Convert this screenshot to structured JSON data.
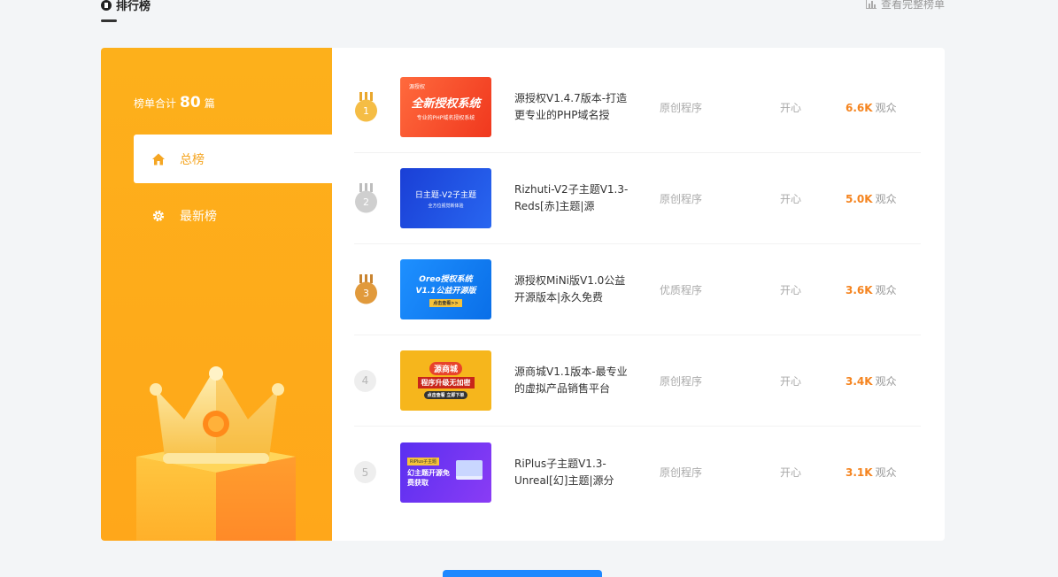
{
  "header": {
    "title": "排行榜",
    "link_label": "查看完整榜单"
  },
  "summary": {
    "prefix": "榜单合计",
    "count": "80",
    "suffix": "篇"
  },
  "nav": [
    {
      "label": "总榜",
      "icon": "home-icon",
      "active": true
    },
    {
      "label": "最新榜",
      "icon": "gear-icon",
      "active": false
    }
  ],
  "rows": [
    {
      "rank": "1",
      "thumb_text": "全新授权系统",
      "thumb_sub": "专业的PHP域名授权系统",
      "thumb_tag": "源授权",
      "title": "源授权V1.4.7版本-打造更专业的PHP域名授",
      "category": "原创程序",
      "author": "开心",
      "views": "6.6K",
      "views_unit": "观众"
    },
    {
      "rank": "2",
      "thumb_text": "日主题-V2子主题",
      "thumb_sub": "全方位视觉新体验",
      "thumb_tag": "",
      "title": "Rizhuti-V2子主题V1.3-Reds[赤]主题|源",
      "category": "原创程序",
      "author": "开心",
      "views": "5.0K",
      "views_unit": "观众"
    },
    {
      "rank": "3",
      "thumb_text": "Oreo授权系统",
      "thumb_sub": "V1.1公益开源版",
      "thumb_tag": "点击查看>>",
      "title": "源授权MiNi版V1.0公益开源版本|永久免费",
      "category": "优质程序",
      "author": "开心",
      "views": "3.6K",
      "views_unit": "观众"
    },
    {
      "rank": "4",
      "thumb_text": "源商城",
      "thumb_sub": "程序升级无加密",
      "thumb_tag": "点击查看 立即下单",
      "title": "源商城V1.1版本-最专业的虚拟产品销售平台",
      "category": "原创程序",
      "author": "开心",
      "views": "3.4K",
      "views_unit": "观众"
    },
    {
      "rank": "5",
      "thumb_text": "幻主题开源免费获取",
      "thumb_sub": "",
      "thumb_tag": "RiPlus子主题",
      "title": "RiPlus子主题V1.3-Unreal[幻]主题|源分",
      "category": "原创程序",
      "author": "开心",
      "views": "3.1K",
      "views_unit": "观众"
    }
  ],
  "colors": {
    "panel": "#ffab1a",
    "accent": "#f5841f",
    "gold": "#f3b53a",
    "silver": "#c9c9c9",
    "bronze": "#d98c2e",
    "button": "#1e88ff"
  }
}
